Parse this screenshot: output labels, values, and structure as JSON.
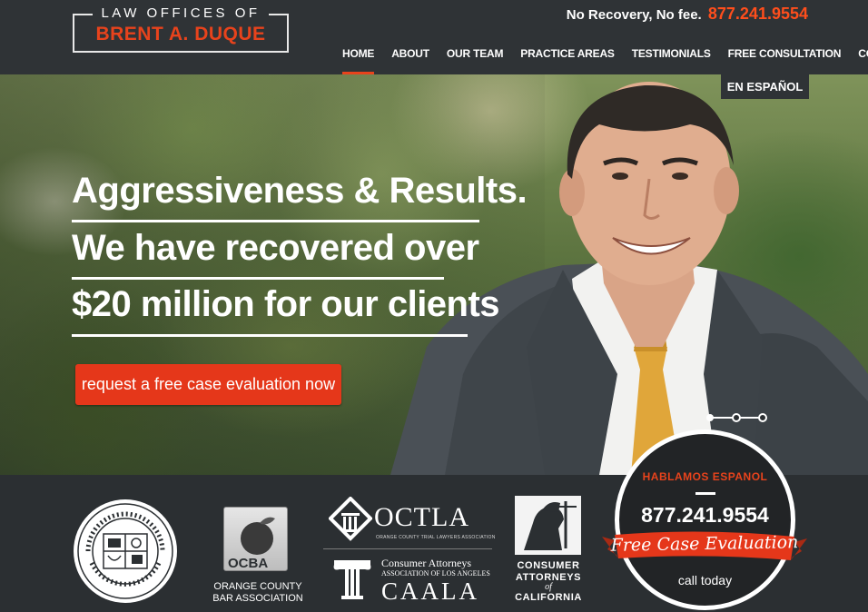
{
  "logo": {
    "line1": "LAW OFFICES OF",
    "line2": "BRENT A. DUQUE"
  },
  "header": {
    "tagline": "No Recovery, No fee.",
    "phone": "877.241.9554"
  },
  "nav": {
    "items": [
      {
        "label": "HOME",
        "active": true
      },
      {
        "label": "ABOUT"
      },
      {
        "label": "OUR TEAM"
      },
      {
        "label": "PRACTICE AREAS"
      },
      {
        "label": "TESTIMONIALS"
      },
      {
        "label": "FREE CONSULTATION"
      },
      {
        "label": "CONTACT"
      }
    ]
  },
  "hero": {
    "language_button": "EN ESPAÑOL",
    "headline": [
      "Aggressiveness & Results.",
      "We have recovered over",
      "$20 million for our clients"
    ],
    "cta": "request a free case evaluation now"
  },
  "affiliations": {
    "ocba_caption": "ORANGE COUNTY BAR ASSOCIATION",
    "ocba_mark": "OCBA",
    "octla": "OCTLA",
    "octla_sub": "ORANGE COUNTY TRIAL LAWYERS ASSOCIATION",
    "caala_line1": "Consumer Attorneys",
    "caala_line2": "ASSOCIATION OF LOS ANGELES",
    "caala": "CAALA",
    "cac_line1": "CONSUMER",
    "cac_line2": "ATTORNEYS",
    "cac_of": "of",
    "cac_line3": "CALIFORNIA"
  },
  "badge": {
    "habla": "HABLAMOS ESPANOL",
    "phone": "877.241.9554",
    "ribbon": "Free Case Evaluation",
    "call": "call today"
  },
  "colors": {
    "accent": "#e8431c",
    "header_bg": "#2f3336",
    "band_bg": "#2b2f32"
  }
}
